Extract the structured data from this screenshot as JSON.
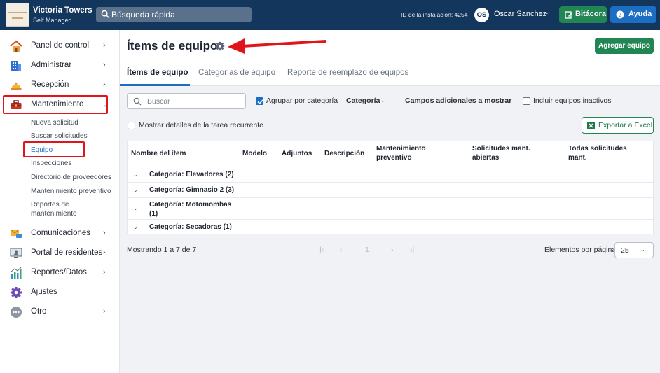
{
  "brand": {
    "title": "Victoria Towers",
    "subtitle": "Self Managed"
  },
  "topbar": {
    "search_placeholder": "Búsqueda rápida",
    "install_id": "ID de la instalación: 4254",
    "avatar_initials": "OS",
    "user_name": "Oscar Sanchez",
    "log_button": "Bitácora",
    "help_button": "Ayuda"
  },
  "sidebar": {
    "items": [
      {
        "label": "Panel de control",
        "icon": "home-icon"
      },
      {
        "label": "Administrar",
        "icon": "building-icon"
      },
      {
        "label": "Recepción",
        "icon": "reception-bell-icon"
      },
      {
        "label": "Mantenimiento",
        "icon": "toolbox-icon"
      },
      {
        "label": "Comunicaciones",
        "icon": "mail-chat-icon"
      },
      {
        "label": "Portal de residentes",
        "icon": "monitor-user-icon"
      },
      {
        "label": "Reportes/Datos",
        "icon": "bar-chart-icon"
      },
      {
        "label": "Ajustes",
        "icon": "gear-icon"
      },
      {
        "label": "Otro",
        "icon": "more-icon"
      }
    ],
    "maintenance_sub": [
      "Nueva solicitud",
      "Buscar solicitudes",
      "Equipo",
      "Inspecciones",
      "Directorio de proveedores",
      "Mantenimiento preventivo",
      "Reportes de",
      "mantenimiento"
    ]
  },
  "page": {
    "title": "Ítems de equipo",
    "add_button": "Agregar equipo",
    "tabs": [
      "Ítems de equipo",
      "Categorías de equipo",
      "Reporte de reemplazo de equipos"
    ]
  },
  "toolbar": {
    "search_placeholder": "Buscar",
    "group_by_category": "Agrupar por categoría",
    "category_dropdown": "Categoría",
    "extra_fields_dropdown": "Campos adicionales a mostrar",
    "include_inactive": "Incluir equipos inactivos",
    "show_recurring_details": "Mostrar detalles de la tarea recurrente",
    "export_button": "Exportar a Excel"
  },
  "table": {
    "headers": {
      "name": "Nombre del ítem",
      "model": "Modelo",
      "attachments": "Adjuntos",
      "description": "Descripción",
      "preventive_1": "Mantenimiento",
      "preventive_2": "preventivo",
      "open_1": "Solicitudes mant.",
      "open_2": "abiertas",
      "all_1": "Todas solicitudes",
      "all_2": "mant."
    },
    "groups": [
      "Categoría: Elevadores (2)",
      "Categoría: Gimnasio 2 (3)",
      "Categoría: Motomombas",
      "(1)",
      "Categoría: Secadoras (1)"
    ]
  },
  "pagination": {
    "showing": "Mostrando 1 a 7 de 7",
    "first": "|‹",
    "prev": "‹",
    "page": "1",
    "next": "›",
    "last": "›|",
    "per_page_label": "Elementos por página",
    "per_page_value": "25"
  },
  "colors": {
    "topbar": "#13365c",
    "green": "#218554",
    "blue": "#1b6ec2",
    "highlight_red": "#e0151b"
  }
}
